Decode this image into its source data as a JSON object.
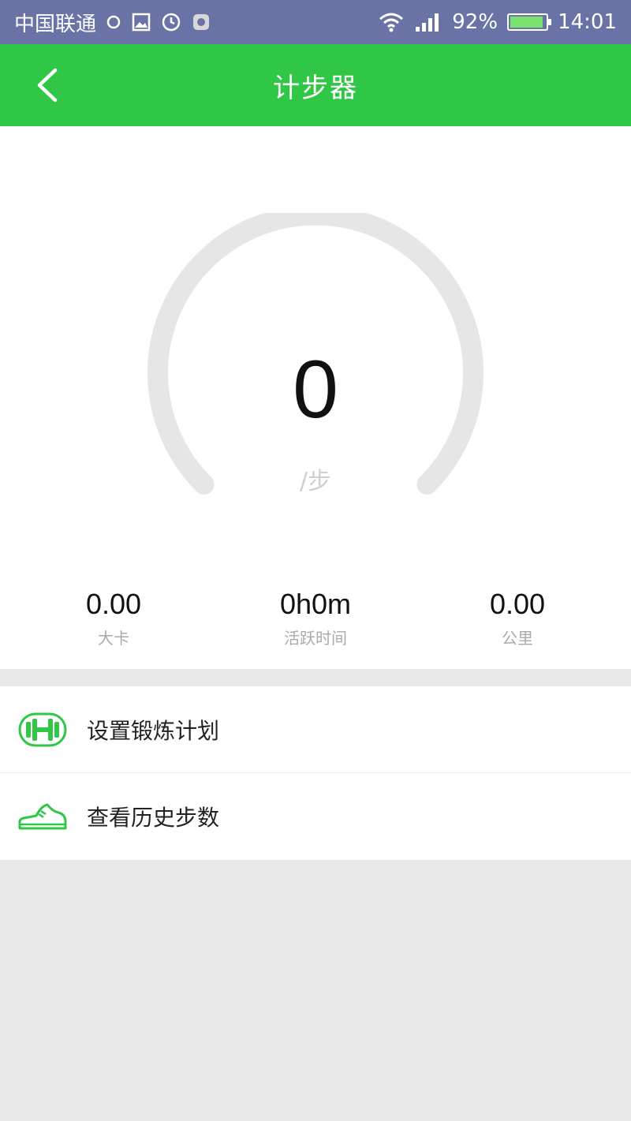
{
  "status_bar": {
    "carrier": "中国联通",
    "battery": "92%",
    "time": "14:01"
  },
  "app_bar": {
    "title": "计步器"
  },
  "pedometer": {
    "steps": "0",
    "unit": "/步",
    "progress": 0
  },
  "stats": [
    {
      "value": "0.00",
      "label": "大卡"
    },
    {
      "value": "0h0m",
      "label": "活跃时间"
    },
    {
      "value": "0.00",
      "label": "公里"
    }
  ],
  "menu": [
    {
      "label": "设置锻炼计划",
      "icon": "dumbbell-icon"
    },
    {
      "label": "查看历史步数",
      "icon": "sneaker-icon"
    }
  ],
  "colors": {
    "status_bar": "#6a73a6",
    "accent": "#30c646",
    "gauge_track": "#e6e6e6"
  }
}
